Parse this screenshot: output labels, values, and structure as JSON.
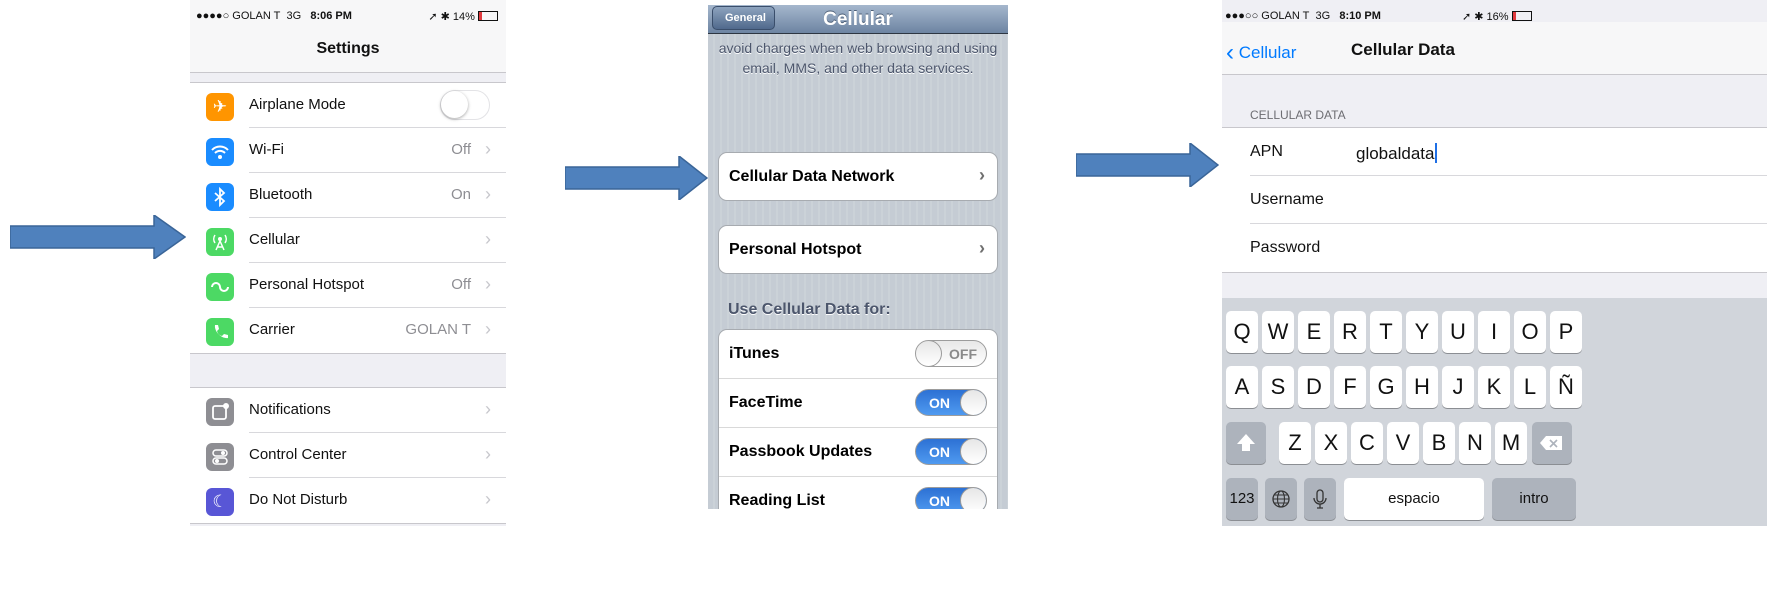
{
  "phone_settings": {
    "status": {
      "carrier": "●●●●○ GOLAN T",
      "network": "3G",
      "time": "8:06 PM",
      "battery": "➚ ✱ 14%"
    },
    "title": "Settings",
    "group1": [
      {
        "label": "Airplane Mode",
        "value": "",
        "icon": "airplane-icon",
        "color": "#ff9500",
        "glyph": "✈"
      },
      {
        "label": "Wi-Fi",
        "value": "Off",
        "icon": "wifi-icon",
        "color": "#1a8cff",
        "glyph": "≋"
      },
      {
        "label": "Bluetooth",
        "value": "On",
        "icon": "bluetooth-icon",
        "color": "#1a8cff",
        "glyph": "✱"
      },
      {
        "label": "Cellular",
        "value": "",
        "icon": "cellular-antenna-icon",
        "color": "#4cd964",
        "glyph": "Ⓐ"
      },
      {
        "label": "Personal Hotspot",
        "value": "Off",
        "icon": "hotspot-icon",
        "color": "#4cd964",
        "glyph": "∞"
      },
      {
        "label": "Carrier",
        "value": "GOLAN T",
        "icon": "phone-icon",
        "color": "#4cd964",
        "glyph": "✆"
      }
    ],
    "group2": [
      {
        "label": "Notifications",
        "value": "",
        "icon": "notifications-icon",
        "color": "#8e8e93",
        "glyph": "▢"
      },
      {
        "label": "Control Center",
        "value": "",
        "icon": "control-center-icon",
        "color": "#8e8e93",
        "glyph": "☰"
      },
      {
        "label": "Do Not Disturb",
        "value": "",
        "icon": "moon-icon",
        "color": "#5856d6",
        "glyph": "☾"
      }
    ]
  },
  "phone_cellular": {
    "back": "General",
    "title": "Cellular",
    "blurb": "avoid charges when web browsing and using email, MMS, and other data services.",
    "items": [
      "Cellular Data Network",
      "Personal Hotspot"
    ],
    "section_header": "Use Cellular Data for:",
    "toggles": [
      {
        "label": "iTunes",
        "state": "OFF"
      },
      {
        "label": "FaceTime",
        "state": "ON"
      },
      {
        "label": "Passbook Updates",
        "state": "ON"
      },
      {
        "label": "Reading List",
        "state": "ON"
      }
    ]
  },
  "phone_data": {
    "status": {
      "carrier": "●●●○○ GOLAN T",
      "network": "3G",
      "time": "8:10 PM",
      "battery": "➚ ✱ 16%"
    },
    "back": "Cellular",
    "title": "Cellular Data",
    "section_header": "CELLULAR DATA",
    "fields": [
      {
        "label": "APN",
        "value": "globaldata"
      },
      {
        "label": "Username",
        "value": ""
      },
      {
        "label": "Password",
        "value": ""
      }
    ],
    "keyboard": {
      "row1": [
        "Q",
        "W",
        "E",
        "R",
        "T",
        "Y",
        "U",
        "I",
        "O",
        "P"
      ],
      "row2": [
        "A",
        "S",
        "D",
        "F",
        "G",
        "H",
        "J",
        "K",
        "L",
        "Ñ"
      ],
      "row3": [
        "Z",
        "X",
        "C",
        "V",
        "B",
        "N",
        "M"
      ],
      "numbers": "123",
      "space": "espacio",
      "return": "intro"
    }
  }
}
